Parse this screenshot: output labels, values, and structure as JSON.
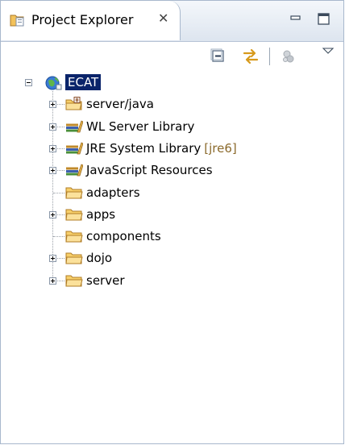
{
  "view": {
    "tab_title": "Project Explorer",
    "tab_icon": "project-explorer-icon",
    "close_glyph": "✕"
  },
  "window_controls": [
    {
      "name": "minimize-icon"
    },
    {
      "name": "maximize-icon"
    }
  ],
  "toolbar": [
    {
      "name": "collapse-all-icon"
    },
    {
      "name": "link-with-editor-icon"
    },
    {
      "name": "disabled-action-icon"
    },
    {
      "name": "view-menu-chevron-icon"
    }
  ],
  "tree": {
    "root": {
      "label": "ECAT",
      "icon": "web-project-icon",
      "expanded": true,
      "selected": true
    },
    "children": [
      {
        "label": "server/java",
        "icon": "source-folder-icon",
        "expandable": true
      },
      {
        "label": "WL Server Library",
        "icon": "library-icon",
        "expandable": true
      },
      {
        "label": "JRE System Library",
        "decoration": "[jre6]",
        "icon": "library-icon",
        "expandable": true
      },
      {
        "label": "JavaScript Resources",
        "icon": "library-icon",
        "expandable": true
      },
      {
        "label": "adapters",
        "icon": "folder-icon",
        "expandable": false
      },
      {
        "label": "apps",
        "icon": "folder-icon",
        "expandable": true
      },
      {
        "label": "components",
        "icon": "folder-icon",
        "expandable": false
      },
      {
        "label": "dojo",
        "icon": "folder-icon",
        "expandable": true
      },
      {
        "label": "server",
        "icon": "folder-icon",
        "expandable": true
      }
    ]
  },
  "colors": {
    "selection_bg": "#0a246a",
    "decoration_text": "#8b6a2c",
    "tab_border": "#a8b8cd"
  }
}
